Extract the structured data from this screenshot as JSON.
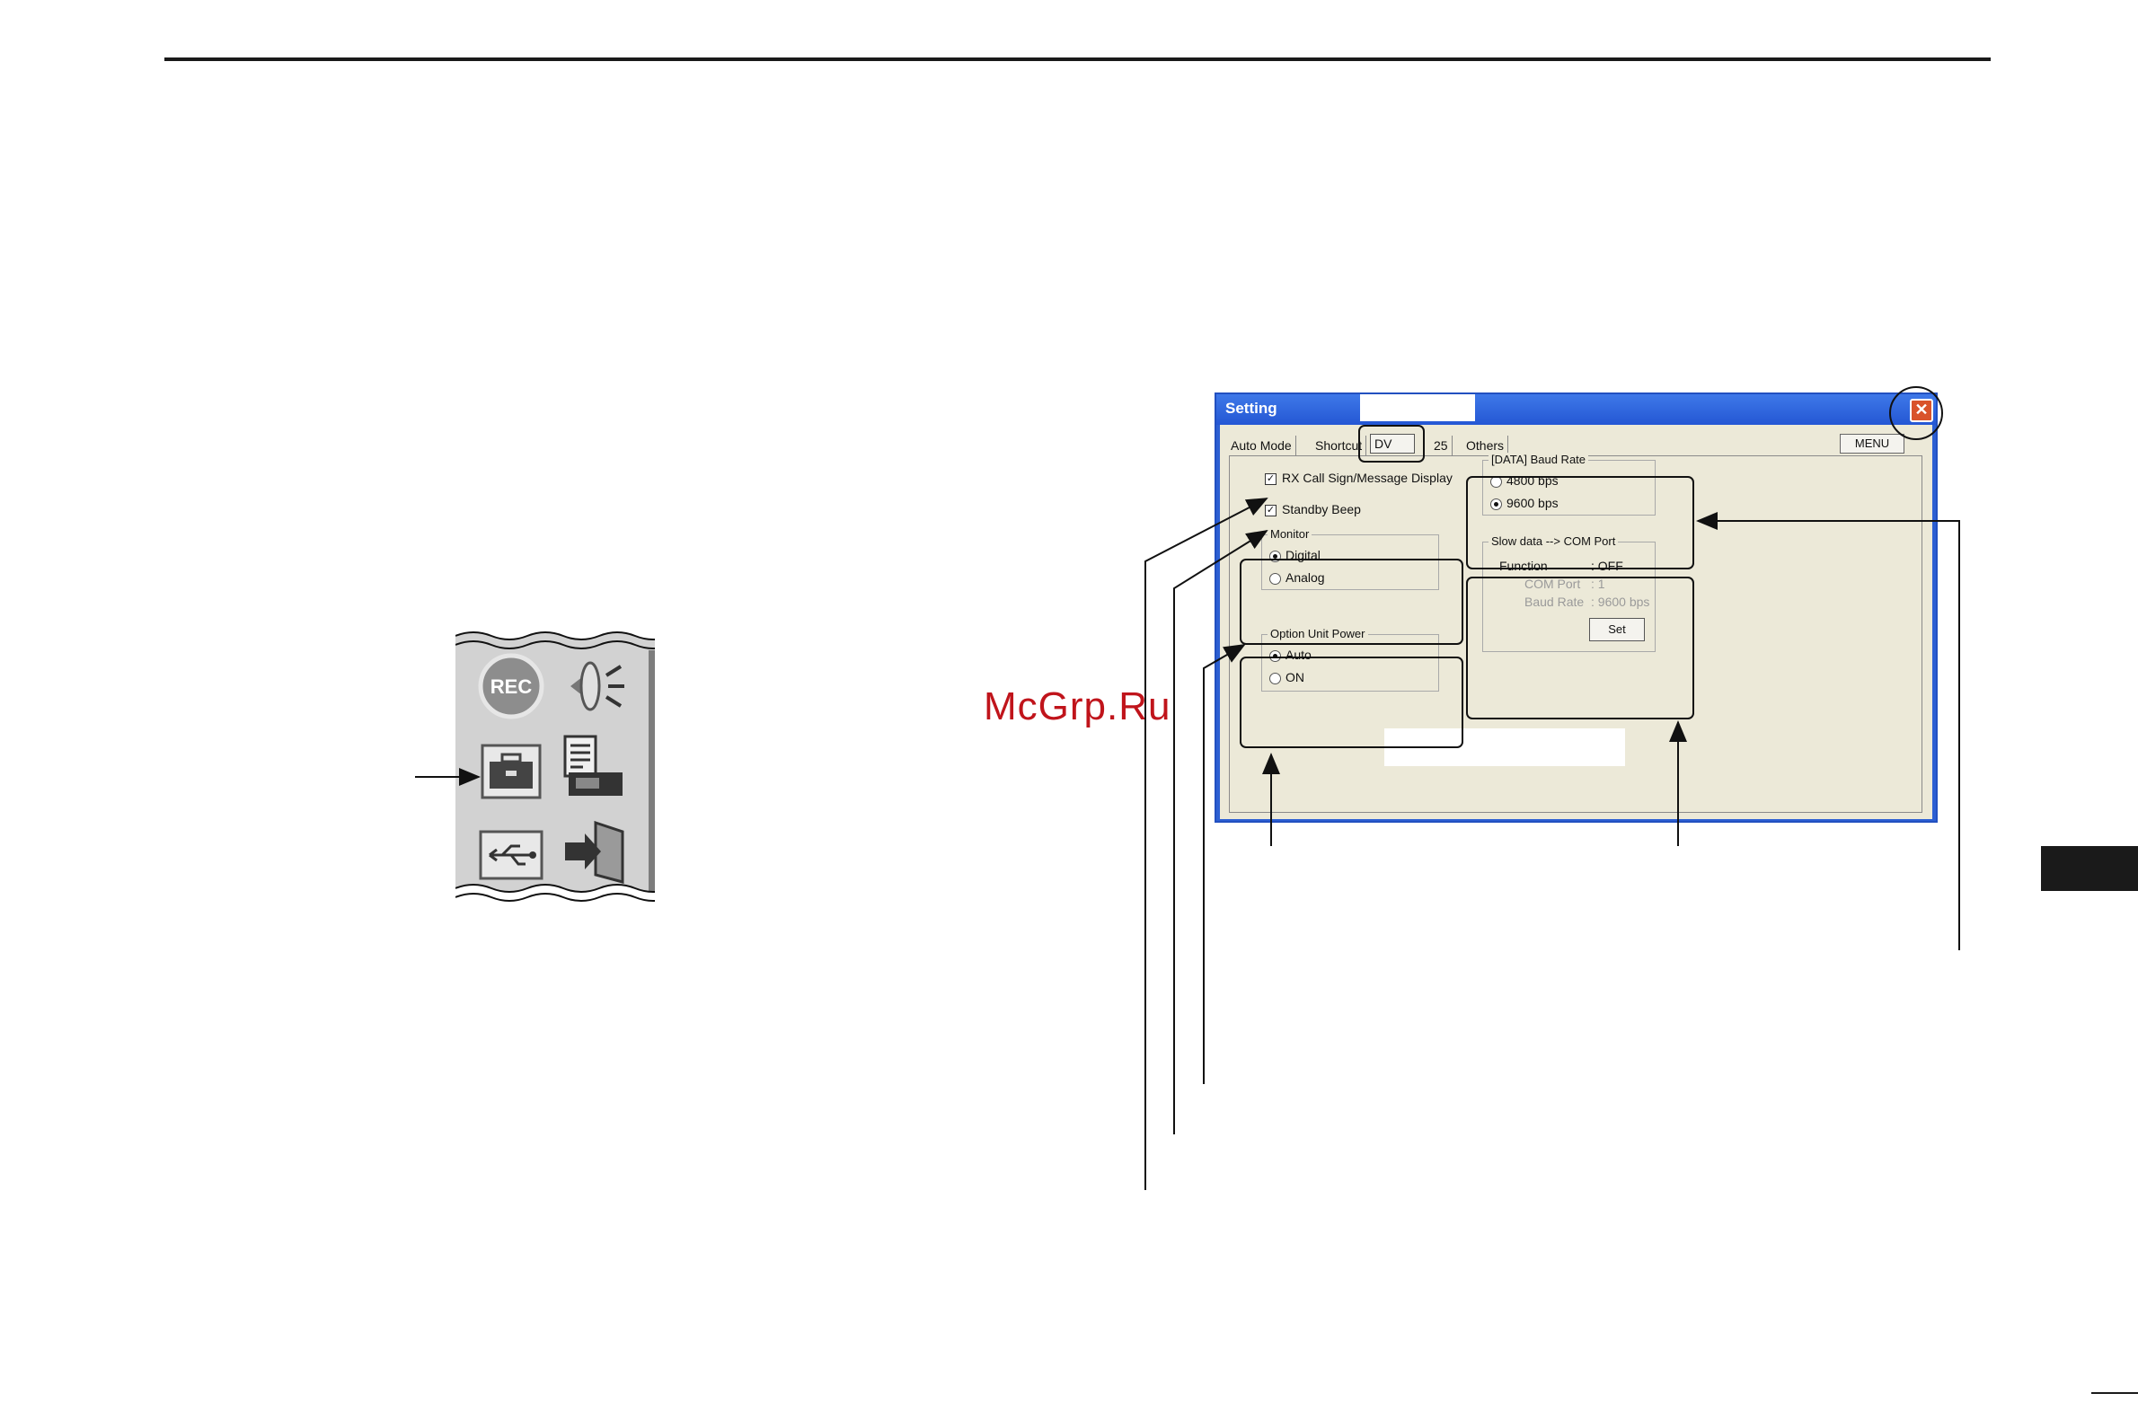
{
  "watermark": "McGrp.Ru",
  "window": {
    "title": "Setting",
    "close_glyph": "✕",
    "tabs": [
      "Auto Mode",
      "Shortcut",
      "DV",
      "25",
      "Others"
    ],
    "active_tab": "DV",
    "menu_button": "MENU"
  },
  "checkboxes": [
    {
      "label": "RX Call Sign/Message Display",
      "checked": true
    },
    {
      "label": "Standby Beep",
      "checked": true
    }
  ],
  "monitor": {
    "title": "Monitor",
    "options": [
      "Digital",
      "Analog"
    ],
    "selected": "Digital"
  },
  "option_unit_power": {
    "title": "Option Unit Power",
    "options": [
      "Auto",
      "ON"
    ],
    "selected": "Auto"
  },
  "baud_rate": {
    "title": "[DATA] Baud Rate",
    "options": [
      "4800 bps",
      "9600 bps"
    ],
    "selected": "9600 bps"
  },
  "slow_data": {
    "title": "Slow data --> COM Port",
    "rows": [
      {
        "key": "Function",
        "value": ": OFF",
        "enabled": true
      },
      {
        "key": "COM Port",
        "value": ": 1",
        "enabled": false
      },
      {
        "key": "Baud Rate",
        "value": ": 9600 bps",
        "enabled": false
      }
    ],
    "set_button": "Set"
  },
  "toolbar_icons": [
    "rec-icon",
    "speaker-icon",
    "toolbox-icon",
    "radio-memo-icon",
    "usb-icon",
    "exit-door-icon"
  ]
}
